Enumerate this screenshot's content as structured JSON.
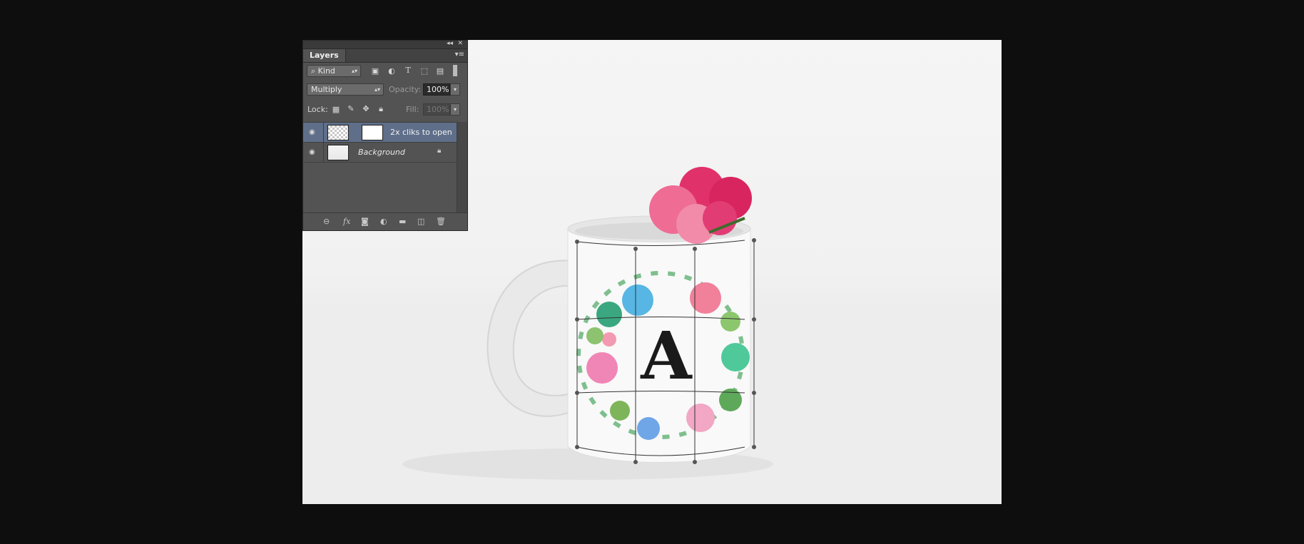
{
  "panel": {
    "tab_label": "Layers",
    "filter": {
      "label": "Kind"
    },
    "blend_mode": "Multiply",
    "opacity_label": "Opacity:",
    "opacity_value": "100%",
    "lock_label": "Lock:",
    "fill_label": "Fill:",
    "fill_value": "100%",
    "layers": [
      {
        "name": "2x cliks to open",
        "selected": true
      },
      {
        "name": "Background",
        "selected": false
      }
    ]
  },
  "canvas": {
    "monogram_letter": "A"
  },
  "icons": {
    "eye": "eye-icon",
    "lock": "lock-icon",
    "link": "link-icon",
    "fx": "fx-icon",
    "mask": "mask-icon",
    "adjustment": "adjustment-icon",
    "folder": "folder-icon",
    "new_layer": "new-layer-icon",
    "trash": "trash-icon"
  },
  "colors": {
    "panel_bg": "#535353",
    "selected_layer": "#5f6f8a",
    "canvas_bg": "#f2f2f2"
  }
}
